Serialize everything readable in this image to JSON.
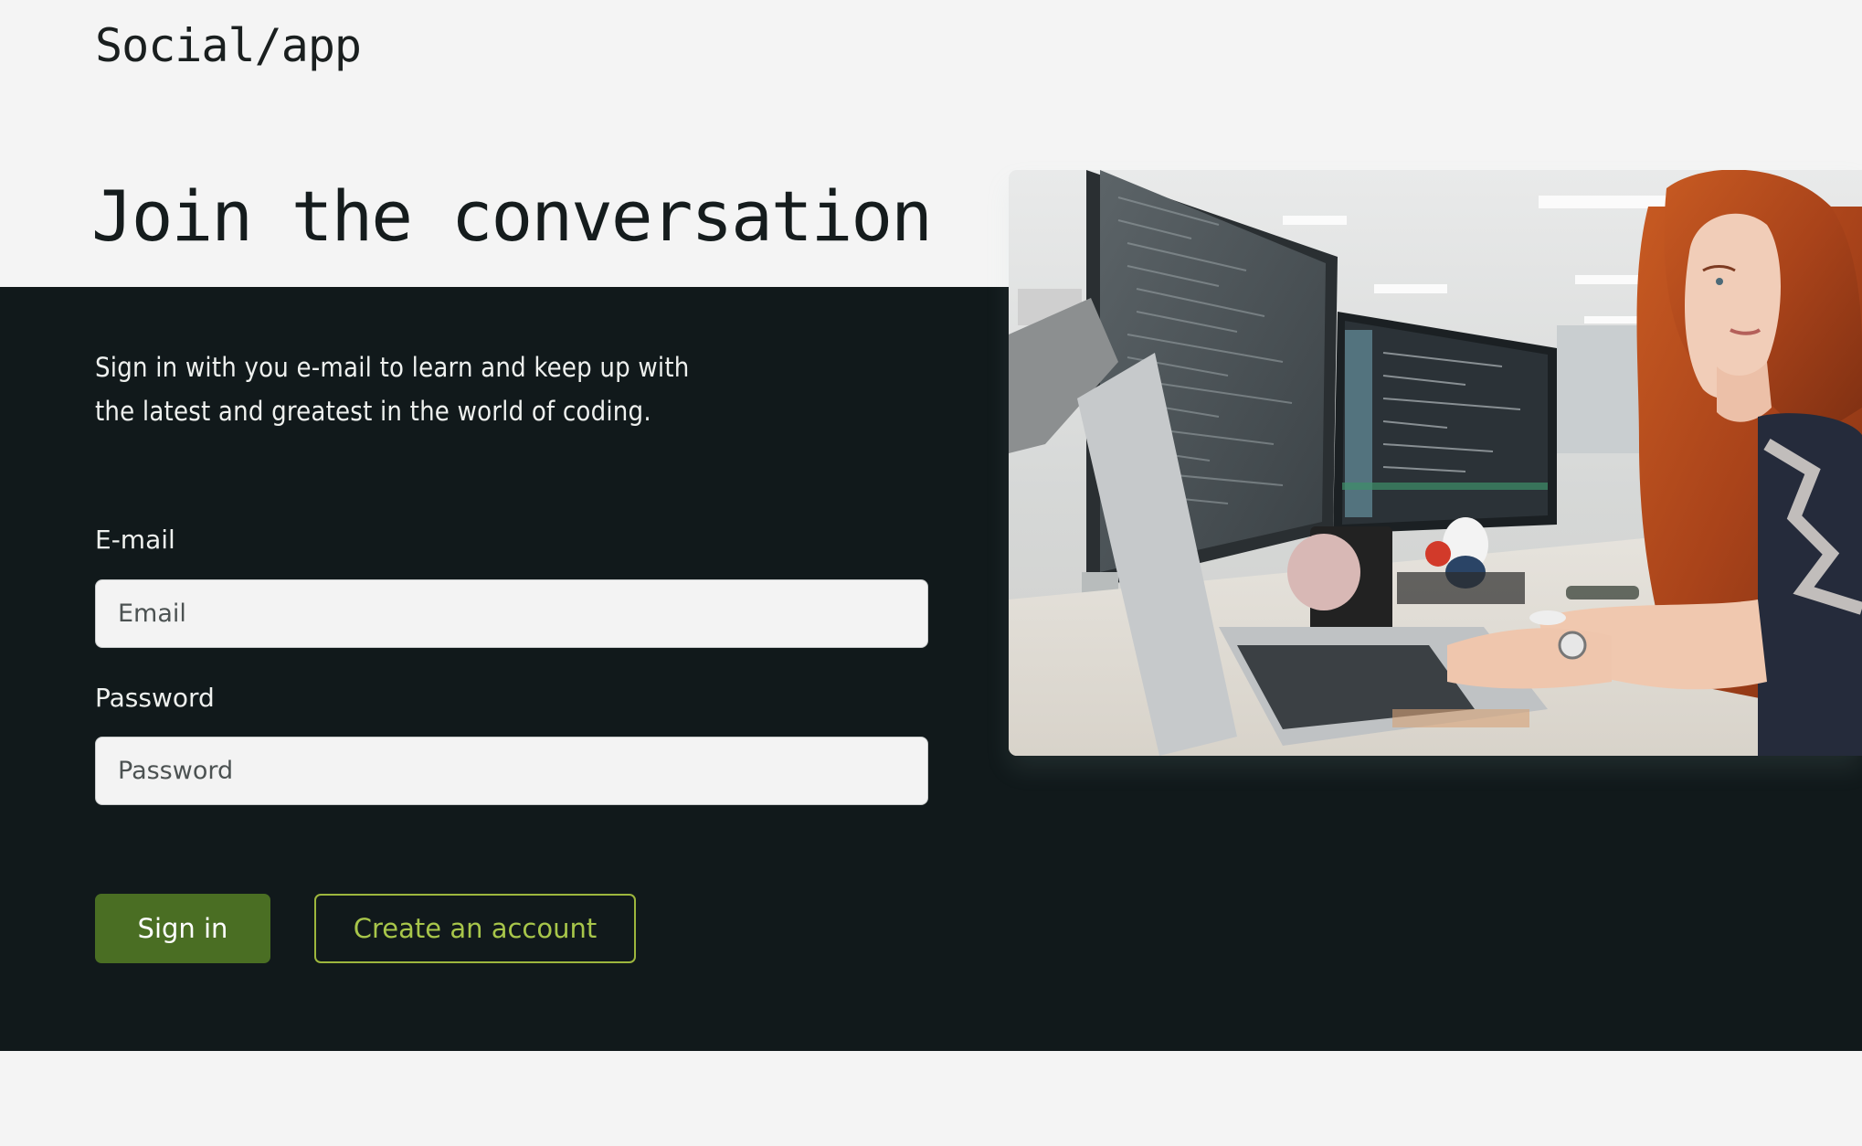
{
  "app": {
    "logo_text": "Social/app"
  },
  "hero": {
    "headline": "Join the conversation",
    "intro": "Sign in with you e-mail to learn and keep up with the latest and greatest in the world of coding.",
    "image_alt": "Woman working at a desk with monitors showing code"
  },
  "form": {
    "email_label": "E-mail",
    "email_placeholder": "Email",
    "password_label": "Password",
    "password_placeholder": "Password",
    "sign_in_label": "Sign in",
    "create_account_label": "Create an account"
  },
  "colors": {
    "page_background": "#f4f4f4",
    "dark_band": "#11191b",
    "primary_button": "#4a6e23",
    "secondary_accent": "#a8c64a"
  }
}
